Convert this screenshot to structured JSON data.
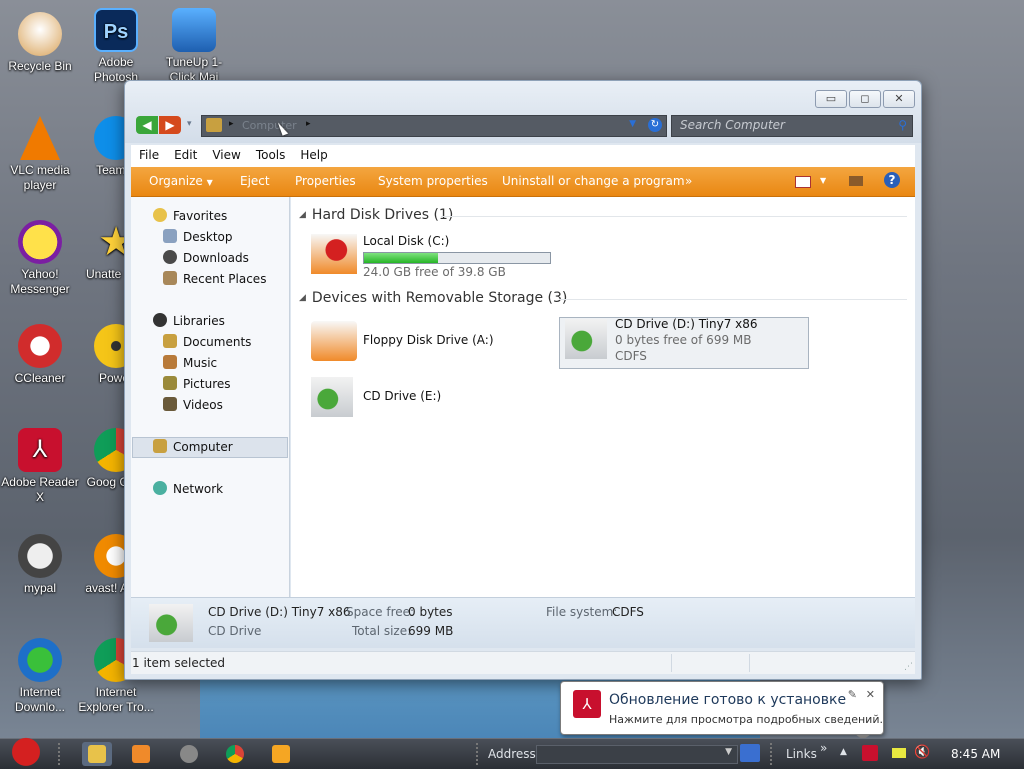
{
  "desktop": {
    "icons": [
      {
        "label": "Recycle Bin"
      },
      {
        "label": "Adobe Photosh"
      },
      {
        "label": "TuneUp 1-Click Mai"
      },
      {
        "label": "VLC media player"
      },
      {
        "label": "TeamVi"
      },
      {
        "label": "Yahoo! Messenger"
      },
      {
        "label": "Unatte Soft"
      },
      {
        "label": "CCleaner"
      },
      {
        "label": "Power"
      },
      {
        "label": "Adobe Reader X"
      },
      {
        "label": "Goog Chro"
      },
      {
        "label": "mypal"
      },
      {
        "label": "avast! Antiv"
      },
      {
        "label": "Internet Downlo..."
      },
      {
        "label": "Internet Explorer Tro..."
      }
    ]
  },
  "window": {
    "address": {
      "crumb": "Computer"
    },
    "search": {
      "placeholder": "Search Computer"
    },
    "menu": [
      "File",
      "Edit",
      "View",
      "Tools",
      "Help"
    ],
    "commands": [
      "Organize",
      "Eject",
      "Properties",
      "System properties",
      "Uninstall or change a program"
    ],
    "nav": {
      "favorites": "Favorites",
      "desktop": "Desktop",
      "downloads": "Downloads",
      "recent": "Recent Places",
      "libraries": "Libraries",
      "documents": "Documents",
      "music": "Music",
      "pictures": "Pictures",
      "videos": "Videos",
      "computer": "Computer",
      "network": "Network"
    },
    "groups": {
      "hdd": "Hard Disk Drives (1)",
      "removable": "Devices with Removable Storage (3)"
    },
    "drives": {
      "c": {
        "name": "Local Disk (C:)",
        "free_text": "24.0 GB free of 39.8 GB",
        "used_fraction": 0.397
      },
      "a": {
        "name": "Floppy Disk Drive (A:)"
      },
      "d": {
        "name": "CD Drive (D:) Tiny7 x86",
        "free_text": "0 bytes free of 699 MB",
        "fs": "CDFS"
      },
      "e": {
        "name": "CD Drive (E:)"
      }
    },
    "details": {
      "name": "CD Drive (D:) Tiny7 x86",
      "type": "CD Drive",
      "space_free_label": "Space free:",
      "space_free_value": "0 bytes",
      "total_size_label": "Total size:",
      "total_size_value": "699 MB",
      "fs_label": "File system:",
      "fs_value": "CDFS"
    },
    "status": "1 item selected"
  },
  "taskbar": {
    "address_label": "Address",
    "links_label": "Links",
    "clock": "8:45 AM"
  },
  "balloon": {
    "title": "Обновление готово к установке",
    "body": "Нажмите для просмотра подробных сведений."
  },
  "colors": {
    "command_bar": "#e98712",
    "disk_bar": "#27b527",
    "selection": "#dce3ec"
  }
}
